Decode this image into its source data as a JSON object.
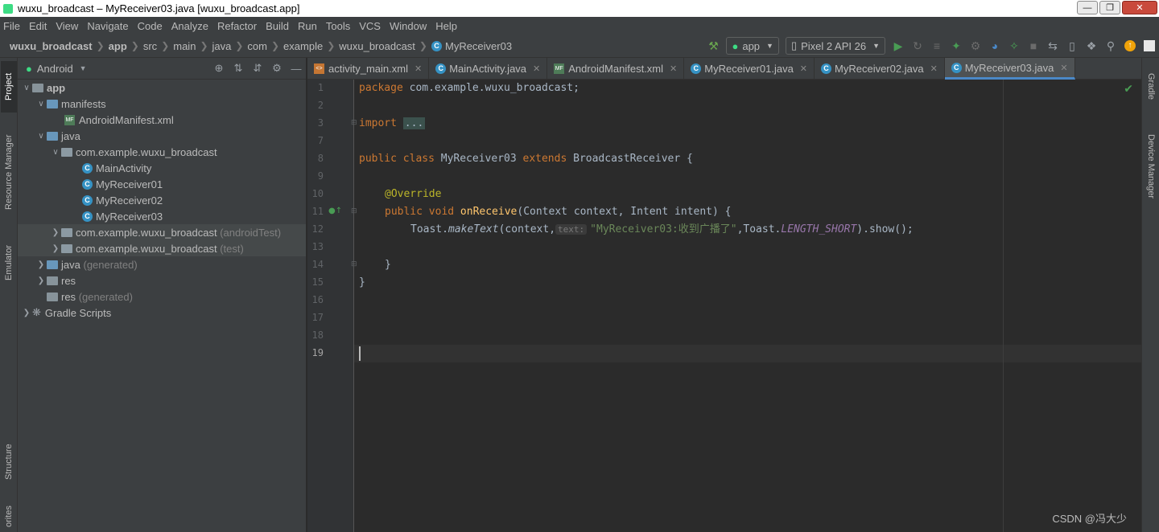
{
  "window": {
    "title": "wuxu_broadcast – MyReceiver03.java [wuxu_broadcast.app]"
  },
  "menu": [
    "File",
    "Edit",
    "View",
    "Navigate",
    "Code",
    "Analyze",
    "Refactor",
    "Build",
    "Run",
    "Tools",
    "VCS",
    "Window",
    "Help"
  ],
  "breadcrumb": [
    "wuxu_broadcast",
    "app",
    "src",
    "main",
    "java",
    "com",
    "example",
    "wuxu_broadcast",
    "MyReceiver03"
  ],
  "toolbar": {
    "run_config": "app",
    "device": "Pixel 2 API 26"
  },
  "left_strip": [
    "Project",
    "Resource Manager",
    "Emulator",
    "Structure",
    "orites"
  ],
  "right_strip": [
    "Gradle",
    "Device Manager"
  ],
  "project_panel": {
    "view_mode": "Android",
    "tree": [
      {
        "label": "app",
        "muted": ""
      },
      {
        "label": "manifests",
        "muted": ""
      },
      {
        "label": "AndroidManifest.xml",
        "muted": ""
      },
      {
        "label": "java",
        "muted": ""
      },
      {
        "label": "com.example.wuxu_broadcast",
        "muted": ""
      },
      {
        "label": "MainActivity",
        "muted": ""
      },
      {
        "label": "MyReceiver01",
        "muted": ""
      },
      {
        "label": "MyReceiver02",
        "muted": ""
      },
      {
        "label": "MyReceiver03",
        "muted": ""
      },
      {
        "label": "com.example.wuxu_broadcast",
        "muted": "(androidTest)"
      },
      {
        "label": "com.example.wuxu_broadcast",
        "muted": "(test)"
      },
      {
        "label": "java",
        "muted": "(generated)"
      },
      {
        "label": "res",
        "muted": ""
      },
      {
        "label": "res",
        "muted": "(generated)"
      },
      {
        "label": "Gradle Scripts",
        "muted": ""
      }
    ]
  },
  "tabs": [
    "activity_main.xml",
    "MainActivity.java",
    "AndroidManifest.xml",
    "MyReceiver01.java",
    "MyReceiver02.java",
    "MyReceiver03.java"
  ],
  "editor": {
    "line_numbers": [
      "1",
      "2",
      "3",
      "7",
      "8",
      "9",
      "10",
      "11",
      "12",
      "13",
      "14",
      "15",
      "16",
      "17",
      "18",
      "19"
    ],
    "code": {
      "l1_kw": "package",
      "l1_rest": " com.example.wuxu_broadcast;",
      "l3_kw": "import",
      "l3_fold": "...",
      "l8_kw1": "public class",
      "l8_name": " MyReceiver03 ",
      "l8_kw2": "extends",
      "l8_rest": " BroadcastReceiver {",
      "l10_ann": "@Override",
      "l11_kw": "public void",
      "l11_fn": "onReceive",
      "l11_rest": "(Context context, Intent intent) {",
      "l12_a": "Toast.",
      "l12_fn": "makeText",
      "l12_b": "(context,",
      "l12_hint": "text:",
      "l12_str": "\"MyReceiver03:收到广播了\"",
      "l12_c": ",Toast.",
      "l12_st": "LENGTH_SHORT",
      "l12_d": ").show();",
      "l14": "}",
      "l15": "}"
    }
  },
  "watermark": "CSDN @冯大少"
}
